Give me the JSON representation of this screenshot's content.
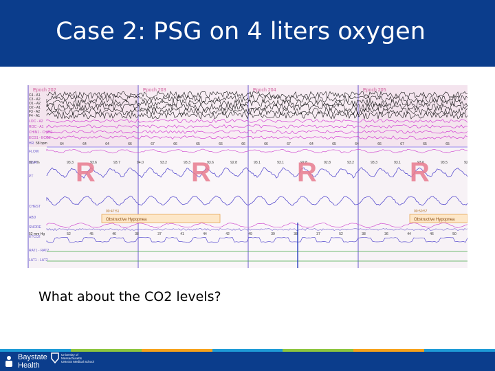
{
  "slide": {
    "title": "Case 2: PSG on 4 liters oxygen",
    "question": "What about the CO2 levels?"
  },
  "psg": {
    "epochs": [
      "Epoch 202",
      "Epoch 203",
      "Epoch 204",
      "Epoch 205"
    ],
    "channels": [
      "C4 - A1",
      "C3 - A2",
      "O1 - A2",
      "O2 - A1",
      "F3 - A2",
      "F4 - A1",
      "LOC - A2",
      "ROC - A1",
      "CHIN1 - CHIN2",
      "ECG1 - ECG2",
      "HR",
      "FLOW",
      "OSAT",
      "PT",
      "CHEST",
      "ABD",
      "SNORE",
      "ETCO2",
      "RAT1 - RAT2",
      "LAT1 - LAT2"
    ],
    "hr_readout": "58 bpm",
    "osat_readout": "92.7 %",
    "etco2_readout": "52 mm Hg",
    "event_label": "Obstructive Hypopnea",
    "event_times": [
      "00:47:51",
      "00:50:57"
    ],
    "arousal_marker": "R",
    "hr_values": [
      "64",
      "64",
      "64",
      "66",
      "67",
      "66",
      "65",
      "66",
      "66",
      "66",
      "67",
      "64",
      "65",
      "64",
      "66",
      "67",
      "65",
      "65",
      "64"
    ],
    "osat_values": [
      "93.3",
      "93.6",
      "93.7",
      "94.0",
      "93.2",
      "93.3",
      "93.6",
      "92.8",
      "93.1",
      "93.1",
      "92.8",
      "92.8",
      "93.2",
      "93.3",
      "93.1",
      "93.6",
      "93.5",
      "92.9"
    ],
    "etco2_values": [
      "52",
      "45",
      "46",
      "38",
      "37",
      "41",
      "44",
      "42",
      "49",
      "39",
      "38",
      "37",
      "52",
      "38",
      "36",
      "44",
      "46",
      "50"
    ]
  },
  "footer": {
    "brand_line1": "Baystate",
    "brand_line2": "Health",
    "umass_line1": "University of",
    "umass_line2": "Massachusetts",
    "umass_line3": "UMASS Medical School",
    "stripe_colors": [
      "#1f9bd7",
      "#8dc63f",
      "#f7a21b",
      "#1f9bd7",
      "#8dc63f",
      "#f7a21b",
      "#1f9bd7"
    ]
  }
}
